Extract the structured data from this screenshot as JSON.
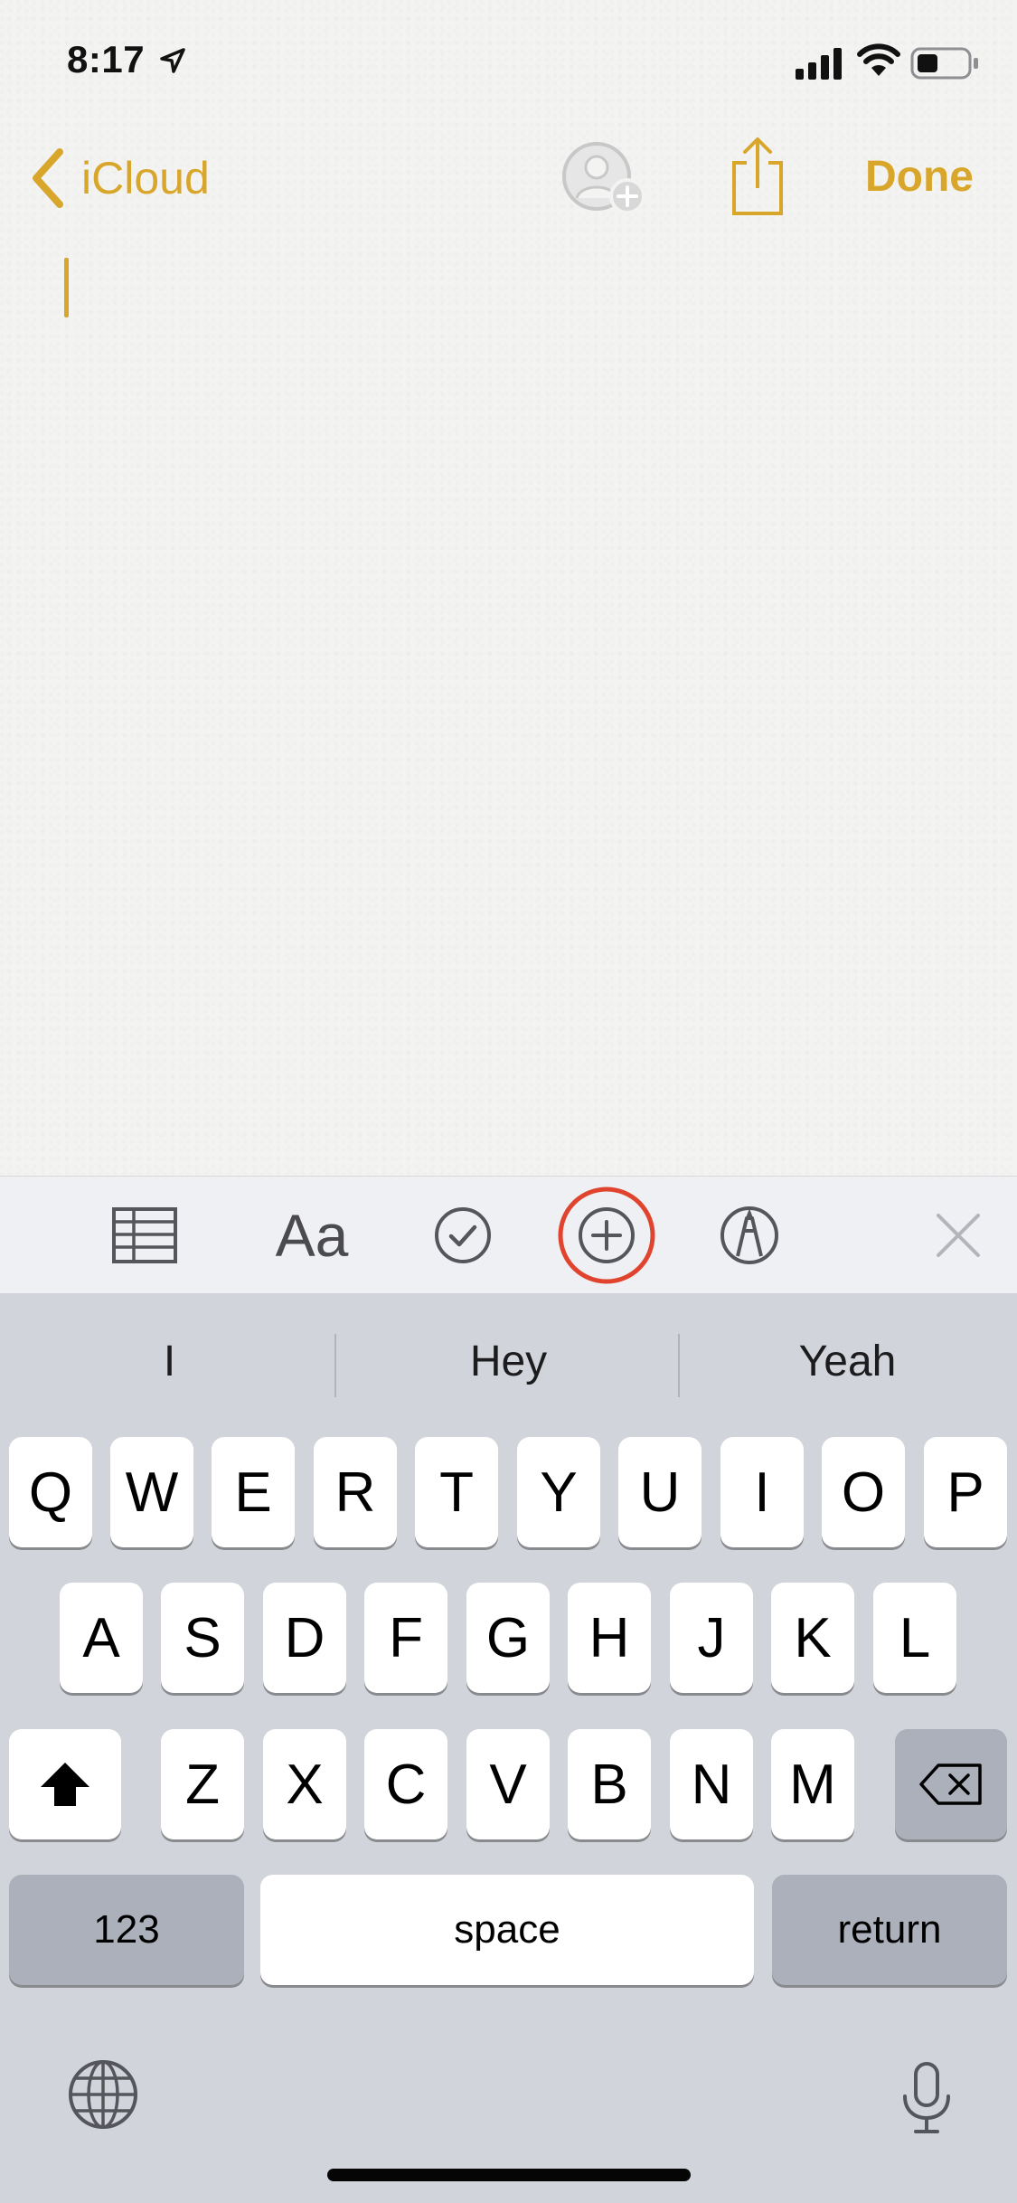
{
  "status_bar": {
    "time": "8:17",
    "icons": [
      "location-arrow-icon",
      "cellular-signal-icon",
      "wifi-icon",
      "battery-icon"
    ]
  },
  "nav": {
    "back_label": "iCloud",
    "done_label": "Done",
    "icons": [
      "chevron-left-icon",
      "add-person-icon",
      "share-icon"
    ]
  },
  "toolbar": {
    "format_label": "Aa",
    "items": [
      "table-icon",
      "text-format",
      "checklist-icon",
      "add-attachment-icon",
      "markup-icon",
      "close-icon"
    ],
    "highlighted": "add-attachment-icon"
  },
  "suggestions": [
    "I",
    "Hey",
    "Yeah"
  ],
  "keyboard": {
    "row1": [
      "Q",
      "W",
      "E",
      "R",
      "T",
      "Y",
      "U",
      "I",
      "O",
      "P"
    ],
    "row2": [
      "A",
      "S",
      "D",
      "F",
      "G",
      "H",
      "J",
      "K",
      "L"
    ],
    "row3": [
      "Z",
      "X",
      "C",
      "V",
      "B",
      "N",
      "M"
    ],
    "numbers_label": "123",
    "space_label": "space",
    "return_label": "return",
    "icons": [
      "shift-icon",
      "backspace-icon",
      "globe-icon",
      "microphone-icon"
    ]
  },
  "colors": {
    "accent": "#d9a62c",
    "highlight_ring": "#e0442e",
    "keyboard_bg": "#d1d4da",
    "toolbar_bg": "#eff0f3"
  }
}
